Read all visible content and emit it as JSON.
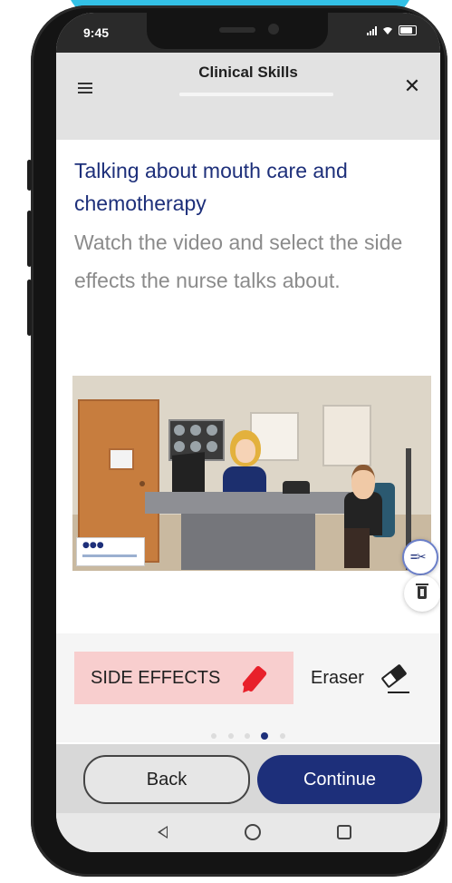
{
  "status_bar": {
    "time": "9:45"
  },
  "header": {
    "title": "Clinical Skills"
  },
  "lesson": {
    "title": "Talking about mouth care and chemotherapy",
    "instructions": "Watch the video and select the side effects the nurse talks about."
  },
  "tools": {
    "highlighter_label": "SIDE EFFECTS",
    "eraser_label": "Eraser",
    "colors": {
      "highlight_bg": "#f8cece",
      "marker": "#e8202a"
    }
  },
  "pagination": {
    "total": 5,
    "current": 4
  },
  "actions": {
    "back_label": "Back",
    "continue_label": "Continue"
  },
  "icons": {
    "menu": "menu-icon",
    "close": "close-icon",
    "compare": "compare-icon",
    "delete": "trash-icon",
    "marker": "marker-icon",
    "eraser": "eraser-icon"
  },
  "theme": {
    "brand_navy": "#1d2f7a",
    "backdrop_cyan": "#33c1e6"
  }
}
